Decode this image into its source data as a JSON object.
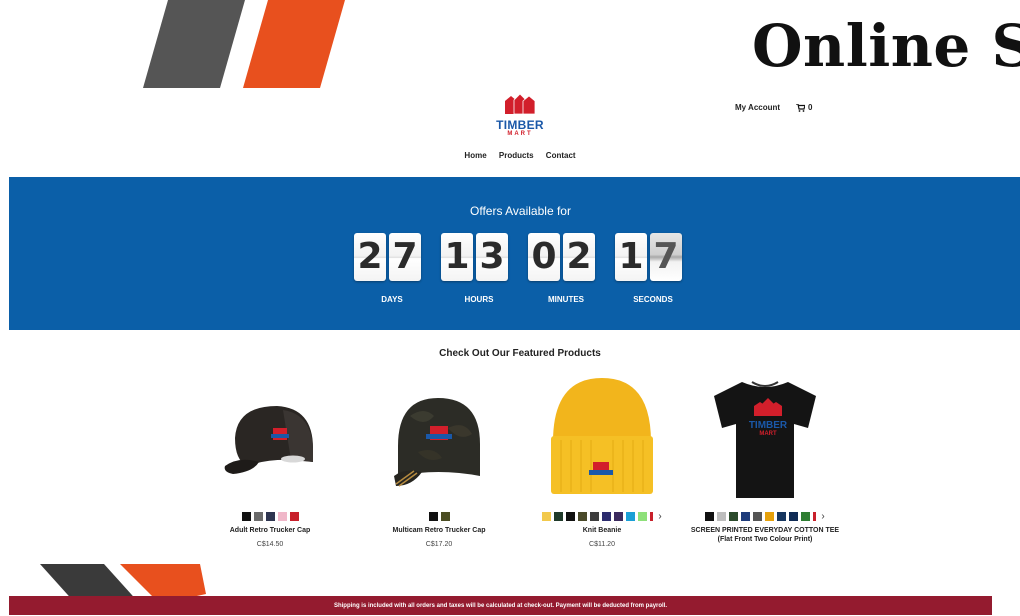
{
  "header": {
    "title": "Online S",
    "account_label": "My Account",
    "cart_count": "0"
  },
  "logo": {
    "word1": "TIMBER",
    "word2": "MART"
  },
  "nav": [
    "Home",
    "Products",
    "Contact"
  ],
  "hero": {
    "title": "Offers Available for",
    "countdown": [
      {
        "digits": [
          "2",
          "7"
        ],
        "label": "DAYS"
      },
      {
        "digits": [
          "1",
          "3"
        ],
        "label": "HOURS"
      },
      {
        "digits": [
          "0",
          "2"
        ],
        "label": "MINUTES"
      },
      {
        "digits": [
          "1",
          "7"
        ],
        "label": "SECONDS"
      }
    ]
  },
  "featured": {
    "title": "Check Out Our Featured Products",
    "products": [
      {
        "name": "Adult Retro Trucker Cap",
        "price": "C$14.50",
        "icon": "trucker-cap-black",
        "swatches": [
          "#111111",
          "#6b6b6b",
          "#2e3550",
          "#f0b7c9",
          "#c8202b"
        ],
        "more": false
      },
      {
        "name": "Multicam Retro Trucker Cap",
        "price": "C$17.20",
        "icon": "trucker-cap-camo",
        "swatches": [
          "#111111",
          "#4b4d22"
        ],
        "more": false
      },
      {
        "name": "Knit Beanie",
        "price": "C$11.20",
        "icon": "knit-beanie-gold",
        "swatches": [
          "#f2c94c",
          "#1f3a2a",
          "#111111",
          "#4a4a2a",
          "#3d3d3d",
          "#2c2c6e",
          "#3b2a5e",
          "#1a9fd6",
          "#8ee07a",
          "#c8202b"
        ],
        "more": true
      },
      {
        "name": "SCREEN PRINTED EVERYDAY COTTON TEE (Flat Front Two Colour Print)",
        "price": "",
        "icon": "tshirt-black",
        "swatches": [
          "#111111",
          "#bdbdbd",
          "#2b4a2b",
          "#1d3b7a",
          "#555555",
          "#e6a10b",
          "#16365f",
          "#0f2b55",
          "#2e7d32",
          "#c8202b"
        ],
        "more": true
      }
    ]
  },
  "footer": {
    "text": "Shipping is included with all orders and taxes will be calculated at check-out. Payment will be deducted from payroll."
  },
  "colors": {
    "hero_blue": "#0b5fa8",
    "footer_red": "#941b2f",
    "accent_orange": "#e8501e",
    "logo_red": "#d21f2b",
    "logo_blue": "#1a58a8"
  }
}
